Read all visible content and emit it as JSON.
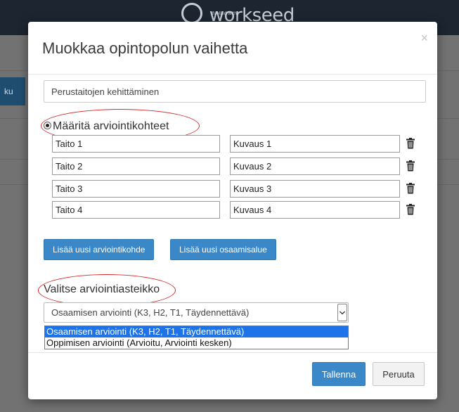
{
  "background": {
    "brand_small": "fuelled with",
    "brand_name": "workseed",
    "side_button_label": "ku"
  },
  "modal": {
    "title": "Muokkaa opintopolun vaihetta",
    "close_glyph": "×",
    "step_name_value": "Perustaitojen kehittäminen",
    "assessment_radio_label": "Määritä arviointikohteet",
    "assessment_targets": [
      {
        "skill": "Taito 1",
        "description": "Kuvaus 1"
      },
      {
        "skill": "Taito 2",
        "description": "Kuvaus 2"
      },
      {
        "skill": "Taito 3",
        "description": "Kuvaus 3"
      },
      {
        "skill": "Taito 4",
        "description": "Kuvaus 4"
      }
    ],
    "add_target_label": "Lisää uusi arviointikohde",
    "add_area_label": "Lisää uusi osaamisalue",
    "scale_label": "Valitse arviointiasteikko",
    "scale_selected": "Osaamisen arviointi (K3, H2, T1, Täydennettävä)",
    "scale_options": [
      "Osaamisen arviointi (K3, H2, T1, Täydennettävä)",
      "Oppimisen arviointi (Arvioitu, Arviointi kesken)"
    ],
    "save_label": "Tallenna",
    "cancel_label": "Peruuta"
  },
  "icons": {
    "delete": "trash-icon",
    "close": "close-icon",
    "dropdown": "chevron-down-icon"
  },
  "colors": {
    "primary_button": "#3a88c8",
    "highlight_annotation": "#d42b2b",
    "selected_option": "#1e73e8",
    "topbar": "#1d2530"
  }
}
